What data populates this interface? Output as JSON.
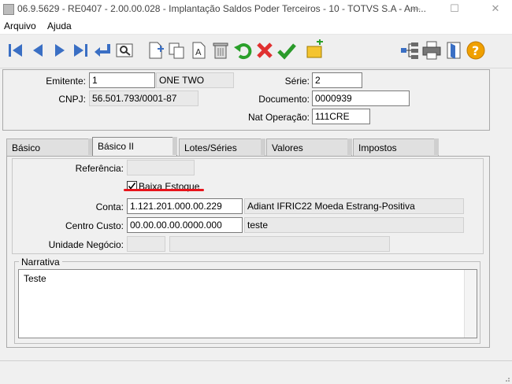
{
  "window": {
    "title": "06.9.5629 - RE0407 - 2.00.00.028 - Implantação Saldos Poder Terceiros - 10 - TOTVS S.A - Am...",
    "minimize": "—",
    "maximize": "☐",
    "close": "✕"
  },
  "menu": {
    "arquivo": "Arquivo",
    "ajuda": "Ajuda"
  },
  "toolbar": {
    "icons": [
      "first-icon",
      "prev-icon",
      "next-icon",
      "last-icon",
      "goto-icon",
      "search-icon",
      "new-icon",
      "copy-icon",
      "edit-icon",
      "delete-icon",
      "undo-icon",
      "cancel-icon",
      "confirm-icon",
      "new-folder-icon",
      "tree-icon",
      "print-icon",
      "exit-icon",
      "help-icon"
    ],
    "colors": {
      "nav": "#3a6fc4",
      "undo": "#2aa02a",
      "cancel": "#e03030",
      "confirm": "#2a9a2a",
      "help": "#f0a000"
    }
  },
  "header": {
    "emitente_label": "Emitente:",
    "emitente_value": "1",
    "emitente_name": "ONE TWO",
    "cnpj_label": "CNPJ:",
    "cnpj_value": "56.501.793/0001-87",
    "serie_label": "Série:",
    "serie_value": "2",
    "documento_label": "Documento:",
    "documento_value": "0000939",
    "natop_label": "Nat Operação:",
    "natop_value": "111CRE"
  },
  "tabs": [
    {
      "label": "Básico"
    },
    {
      "label": "Básico II",
      "active": true
    },
    {
      "label": "Lotes/Séries"
    },
    {
      "label": "Valores"
    },
    {
      "label": "Impostos"
    }
  ],
  "basico2": {
    "referencia_label": "Referência:",
    "referencia_value": "",
    "baixa_estoque_label": "Baixa Estoque",
    "baixa_estoque_checked": true,
    "conta_label": "Conta:",
    "conta_value": "1.121.201.000.00.229",
    "conta_desc": "Adiant IFRIC22 Moeda Estrang-Positiva",
    "centro_label": "Centro Custo:",
    "centro_value": "00.00.00.00.0000.000",
    "centro_desc": "teste",
    "unidade_label": "Unidade Negócio:",
    "unidade_value": "",
    "unidade_desc": "",
    "narrativa_label": "Narrativa",
    "narrativa_value": "Teste",
    "highlight_color": "#e8141b"
  }
}
